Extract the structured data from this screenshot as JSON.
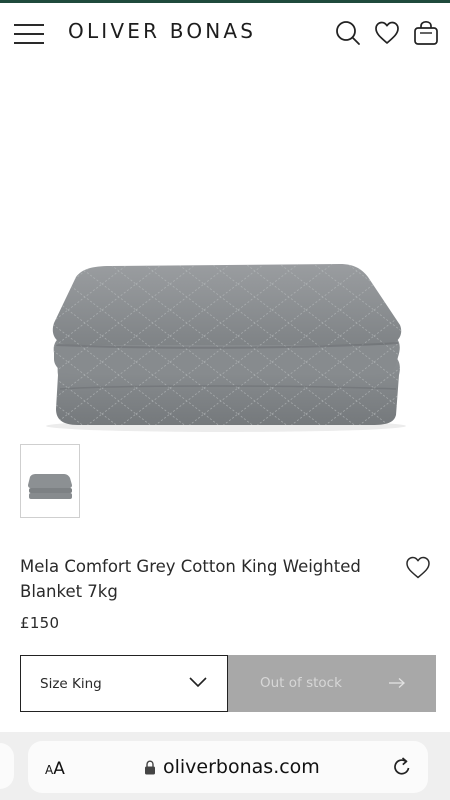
{
  "header": {
    "brand": "OLIVER BONAS",
    "icons": [
      "menu-icon",
      "search-icon",
      "heart-icon",
      "bag-icon"
    ],
    "accent_color": "#1f4a3c"
  },
  "product": {
    "title": "Mela Comfort Grey Cotton King Weighted Blanket 7kg",
    "price": "£150",
    "image_icon": "grey-blanket-image"
  },
  "purchase": {
    "size_label": "Size King",
    "stock_label": "Out of stock",
    "button_color": "#a8a8a8"
  },
  "browser": {
    "text_size_label_big": "A",
    "text_size_label_small": "A",
    "url": "oliverbonas.com"
  }
}
